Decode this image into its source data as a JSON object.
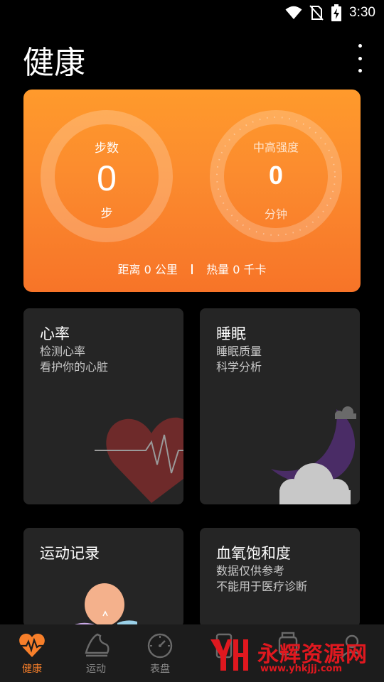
{
  "status_bar": {
    "time": "3:30",
    "icons": [
      "wifi-icon",
      "no-sim-icon",
      "battery-charging-icon"
    ]
  },
  "header": {
    "title": "健康",
    "menu_icon": "more-vert-icon"
  },
  "summary": {
    "steps": {
      "label": "步数",
      "value": "0",
      "unit": "步"
    },
    "intensity": {
      "label": "中高强度",
      "value": "0",
      "unit": "分钟"
    },
    "distance_label": "距离",
    "distance_value": "0",
    "distance_unit": "公里",
    "calorie_label": "热量",
    "calorie_value": "0",
    "calorie_unit": "千卡",
    "colors": {
      "gradient_top": "#ff9a2c",
      "gradient_bottom": "#f77428"
    }
  },
  "tiles": {
    "heart_rate": {
      "title": "心率",
      "line1": "检测心率",
      "line2": "看护你的心脏",
      "icon": "heart-icon",
      "accent": "#8b2f2f"
    },
    "sleep": {
      "title": "睡眠",
      "line1": "睡眠质量",
      "line2": "科学分析",
      "icon": "moon-cloud-icon",
      "accent": "#5e3a78"
    },
    "workout": {
      "title": "运动记录",
      "icon": "runner-icon"
    },
    "spo2": {
      "title": "血氧饱和度",
      "line1": "数据仅供参考",
      "line2": "不能用于医疗诊断",
      "icon": "blood-oxygen-icon"
    }
  },
  "bottom_nav": {
    "items": [
      {
        "label": "健康",
        "icon": "heart-pulse-icon",
        "active": true
      },
      {
        "label": "运动",
        "icon": "shoe-icon",
        "active": false
      },
      {
        "label": "表盘",
        "icon": "watch-dial-icon",
        "active": false
      },
      {
        "label": "",
        "icon": "device-icon",
        "active": false
      },
      {
        "label": "",
        "icon": "watch-icon",
        "active": false
      },
      {
        "label": "",
        "icon": "profile-icon",
        "active": false
      }
    ],
    "active_color": "#f77f2a"
  },
  "watermark": {
    "logo_text": "YH",
    "name": "永辉资源网",
    "url": "www.yhkjjj.com"
  }
}
